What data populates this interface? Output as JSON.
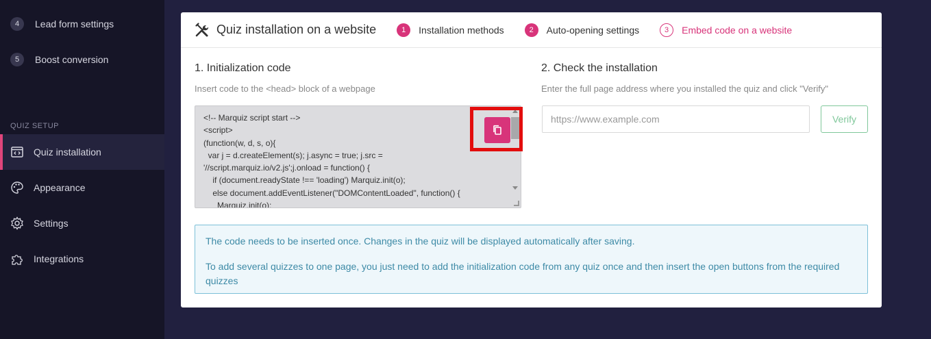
{
  "sidebar": {
    "steps": [
      {
        "num": "4",
        "label": "Lead form settings"
      },
      {
        "num": "5",
        "label": "Boost conversion"
      }
    ],
    "section_label": "QUIZ SETUP",
    "nav": [
      {
        "label": "Quiz installation",
        "icon": "code-window-icon",
        "active": true
      },
      {
        "label": "Appearance",
        "icon": "palette-icon",
        "active": false
      },
      {
        "label": "Settings",
        "icon": "gear-icon",
        "active": false
      },
      {
        "label": "Integrations",
        "icon": "puzzle-icon",
        "active": false
      }
    ]
  },
  "header": {
    "title": "Quiz installation on a website",
    "steps": [
      {
        "num": "1",
        "label": "Installation methods"
      },
      {
        "num": "2",
        "label": "Auto-opening settings"
      },
      {
        "num": "3",
        "label": "Embed code on a website"
      }
    ]
  },
  "init_code": {
    "title": "1. Initialization code",
    "subtitle": "Insert code to the <head> block of a webpage",
    "lines": [
      "<!-- Marquiz script start -->",
      "<script>",
      "(function(w, d, s, o){",
      "  var j = d.createElement(s); j.async = true; j.src =",
      "'//script.marquiz.io/v2.js';j.onload = function() {",
      "    if (document.readyState !== 'loading') Marquiz.init(o);",
      "    else document.addEventListener(\"DOMContentLoaded\", function() {",
      "      Marquiz.init(o);"
    ]
  },
  "check": {
    "title": "2. Check the installation",
    "subtitle": "Enter the full page address where you installed the quiz and click \"Verify\"",
    "placeholder": "https://www.example.com",
    "verify_label": "Verify"
  },
  "info": {
    "p1": "The code needs to be inserted once. Changes in the quiz will be displayed automatically after saving.",
    "p2": "To add several quizzes to one page, you just need to add the initialization code from any quiz once and then insert the open buttons from the required quizzes"
  },
  "colors": {
    "accent": "#d8347a",
    "highlight": "#e30d0d",
    "verify": "#7fc79a",
    "info_text": "#3d8aa6"
  }
}
